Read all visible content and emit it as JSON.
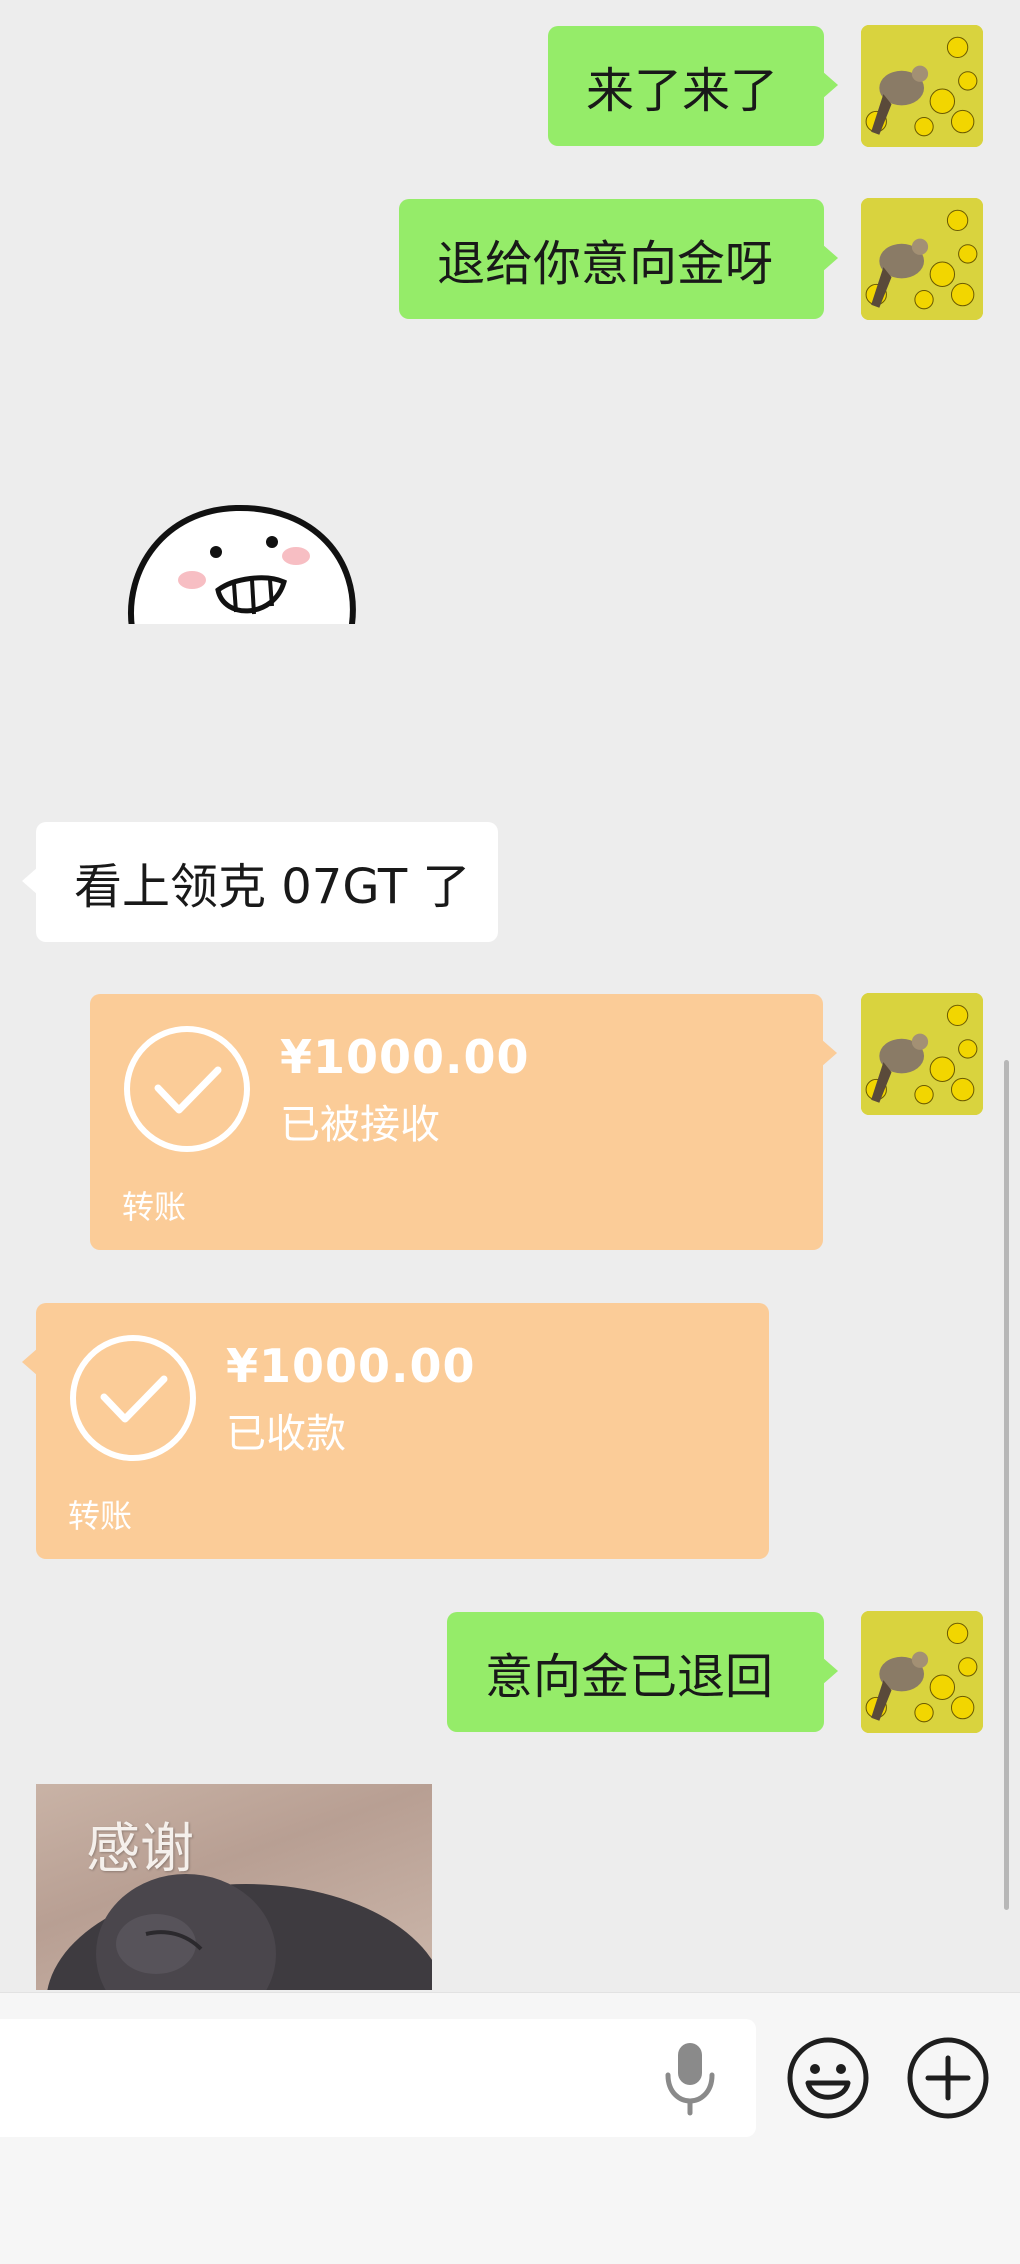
{
  "messages": {
    "m1": "来了来了",
    "m2": "退给你意向金呀",
    "m3": "看上领克 07GT 了",
    "m6": "意向金已退回"
  },
  "transfers": {
    "t1": {
      "amount": "¥1000.00",
      "status": "已被接收",
      "label": "转账"
    },
    "t2": {
      "amount": "¥1000.00",
      "status": "已收款",
      "label": "转账"
    }
  },
  "image_caption": "感谢",
  "input": {
    "value": "",
    "placeholder": ""
  },
  "icons": {
    "voice": "microphone-icon",
    "emoji": "smiley-icon",
    "more": "plus-circle-icon"
  },
  "colors": {
    "background": "#ededed",
    "sent_bubble": "#95ec69",
    "received_bubble": "#ffffff",
    "transfer_card": "#fbcc98"
  }
}
